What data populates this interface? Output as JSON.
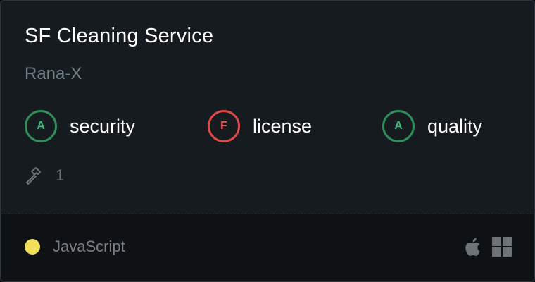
{
  "card": {
    "title": "SF Cleaning Service",
    "owner": "Rana-X"
  },
  "scores": [
    {
      "grade": "A",
      "label": "security",
      "status": "good"
    },
    {
      "grade": "F",
      "label": "license",
      "status": "bad"
    },
    {
      "grade": "A",
      "label": "quality",
      "status": "good"
    }
  ],
  "builds": {
    "icon": "hammer-icon",
    "count": "1"
  },
  "footer": {
    "language": "JavaScript",
    "language_color": "#f1e05a",
    "platforms": [
      "apple-icon",
      "windows-icon"
    ]
  },
  "colors": {
    "grade_good": "#3fb97a",
    "grade_bad": "#ef5858"
  }
}
